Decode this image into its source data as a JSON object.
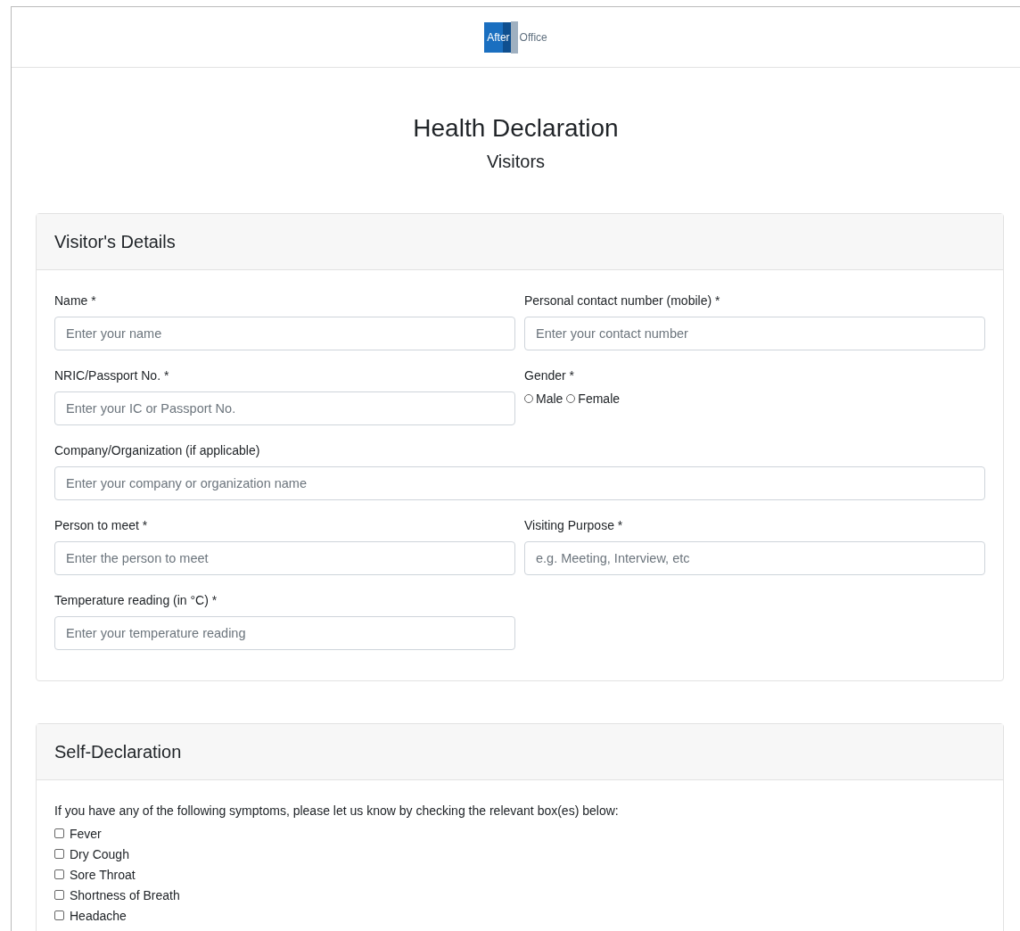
{
  "logo": {
    "part_1": "After",
    "part_2": "Office"
  },
  "title": "Health Declaration",
  "subtitle": "Visitors",
  "visitor_details": {
    "heading": "Visitor's Details",
    "rows": [
      [
        {
          "kind": "text",
          "label": "Name *",
          "placeholder": "Enter your name"
        },
        {
          "kind": "text",
          "label": "Personal contact number (mobile) *",
          "placeholder": "Enter your contact number"
        }
      ],
      [
        {
          "kind": "text",
          "label": "NRIC/Passport No. *",
          "placeholder": "Enter your IC or Passport No."
        },
        {
          "kind": "radio",
          "label": "Gender *",
          "options": [
            {
              "label": "Male",
              "selected": false
            },
            {
              "label": "Female",
              "selected": false
            }
          ]
        }
      ],
      [
        {
          "kind": "wide-text",
          "label": "Company/Organization (if applicable)",
          "placeholder": "Enter your company or organization name"
        }
      ],
      [
        {
          "kind": "text",
          "label": "Person to meet *",
          "placeholder": "Enter the person to meet"
        },
        {
          "kind": "text",
          "label": "Visiting Purpose *",
          "placeholder": "e.g. Meeting, Interview, etc"
        }
      ],
      [
        {
          "kind": "text",
          "label": "Temperature reading (in °C) *",
          "placeholder": "Enter your temperature reading"
        }
      ]
    ]
  },
  "self_declaration": {
    "heading": "Self-Declaration",
    "intro": "If you have any of the following symptoms, please let us know by checking the relevant box(es) below:",
    "symptoms": [
      {
        "label": "Fever",
        "checked": false
      },
      {
        "label": "Dry Cough",
        "checked": false
      },
      {
        "label": "Sore Throat",
        "checked": false
      },
      {
        "label": "Shortness of Breath",
        "checked": false
      },
      {
        "label": "Headache",
        "checked": false
      }
    ]
  }
}
